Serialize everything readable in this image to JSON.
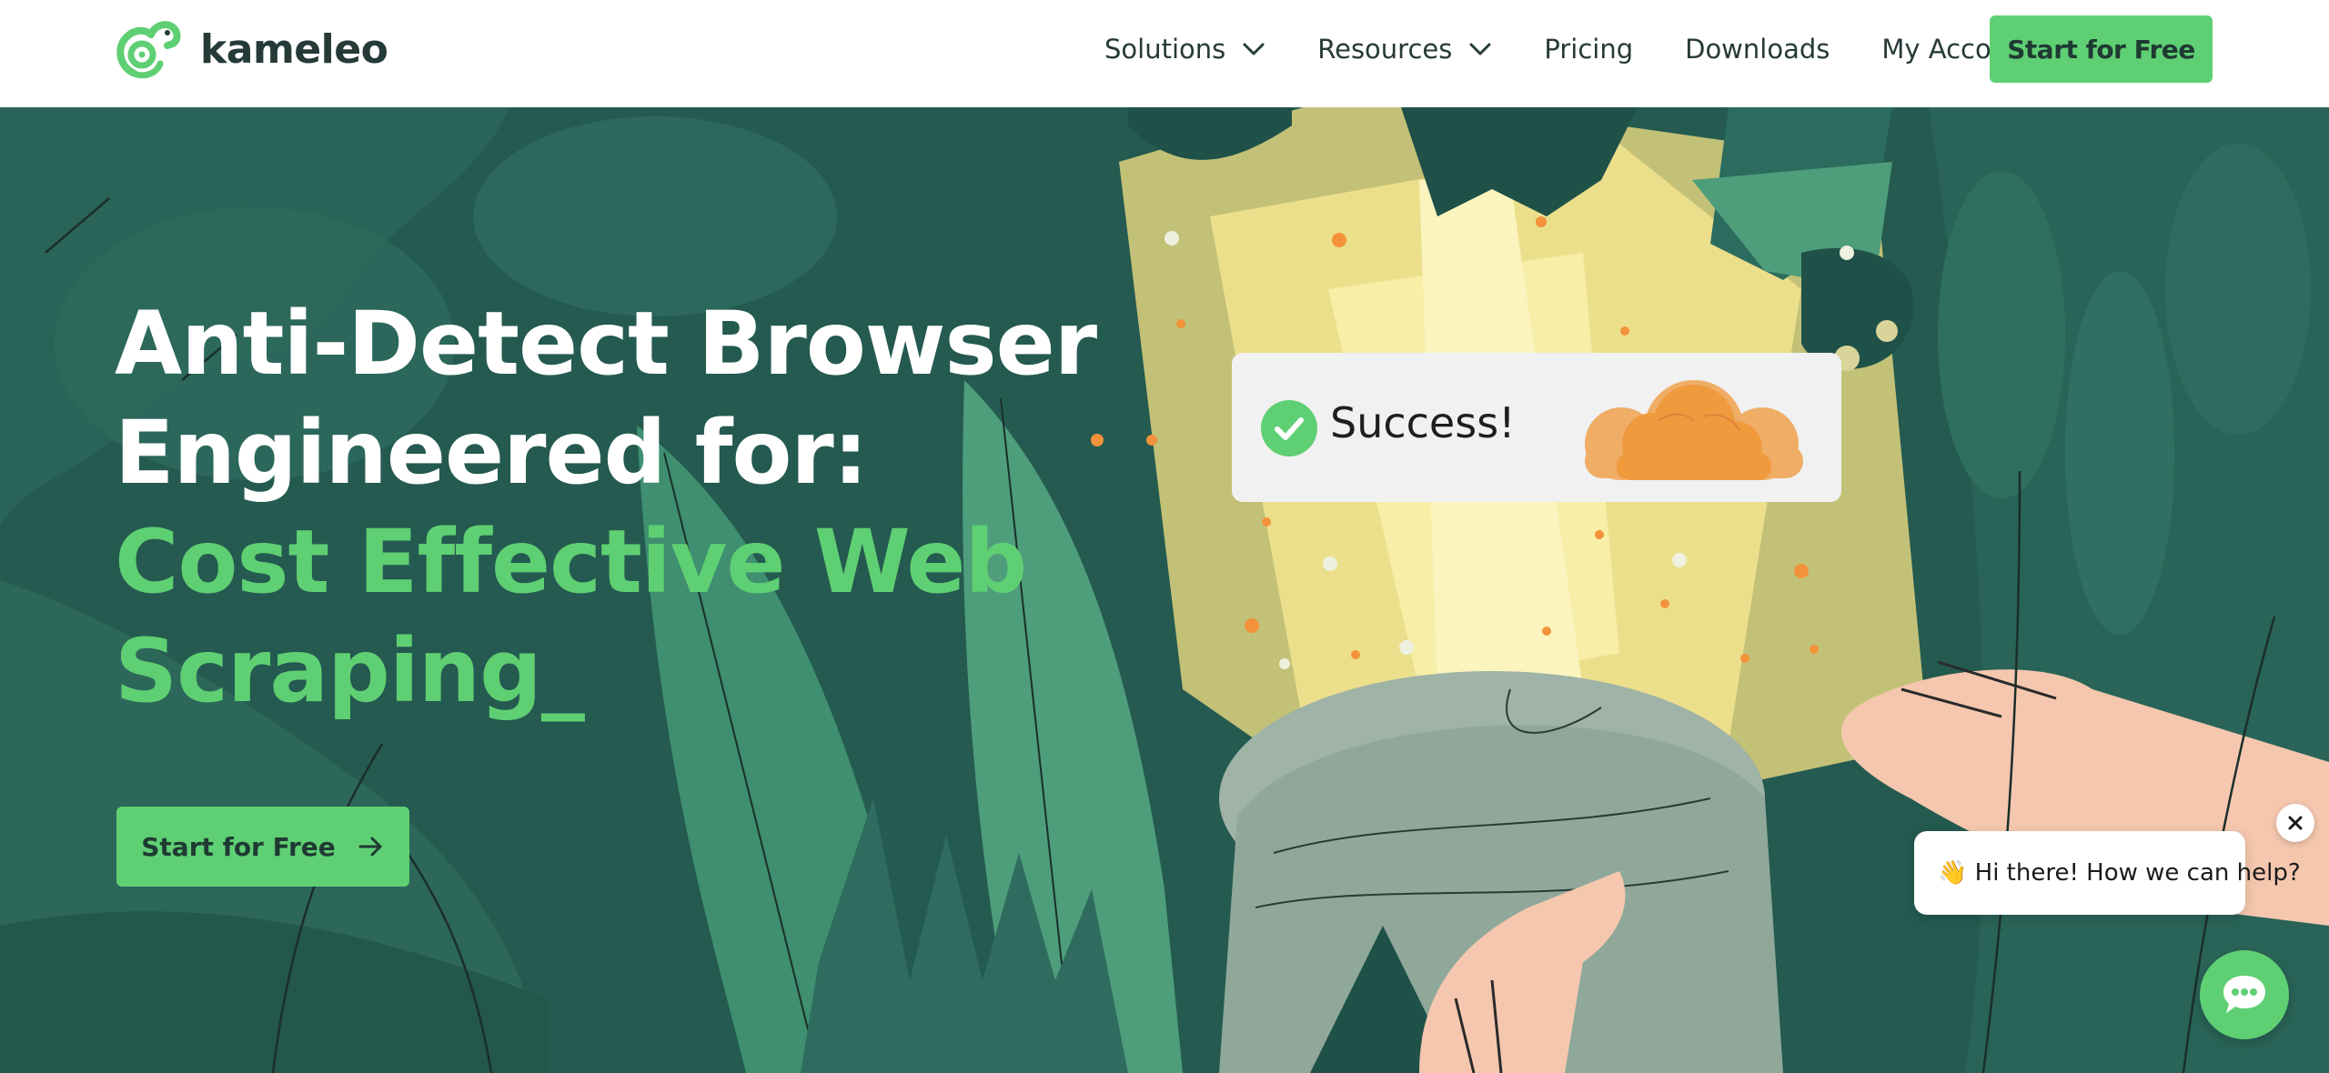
{
  "brand": {
    "name": "kameleo",
    "accent": "#5fcf73",
    "text_dark": "#263a38",
    "hero_bg": "#245a50"
  },
  "nav": {
    "items": [
      {
        "label": "Solutions",
        "has_dropdown": true
      },
      {
        "label": "Resources",
        "has_dropdown": true
      },
      {
        "label": "Pricing",
        "has_dropdown": false
      },
      {
        "label": "Downloads",
        "has_dropdown": false
      },
      {
        "label": "My Account",
        "has_dropdown": false
      }
    ],
    "cta_label": "Start for Free"
  },
  "hero": {
    "headline_line1": "Anti-Detect Browser",
    "headline_line2": "Engineered for:",
    "highlight_line1": "Cost Effective Web",
    "highlight_line2": "Scraping_",
    "cta_label": "Start for Free",
    "success_text": "Success!"
  },
  "chat": {
    "greeting": "👋 Hi there! How we can help?"
  }
}
